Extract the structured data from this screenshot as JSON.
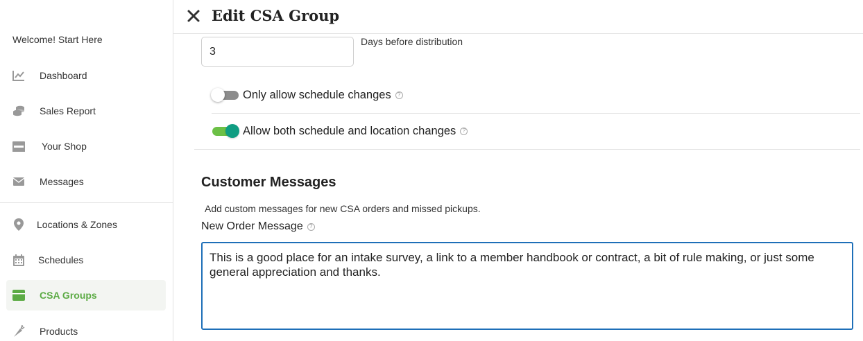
{
  "sidebar": {
    "welcome": "Welcome! Start Here",
    "items": [
      {
        "label": "Dashboard",
        "icon": "chart-line-icon"
      },
      {
        "label": "Sales Report",
        "icon": "coins-icon"
      },
      {
        "label": "Your Shop",
        "icon": "store-icon"
      },
      {
        "label": "Messages",
        "icon": "envelope-icon"
      },
      {
        "label": "Locations & Zones",
        "icon": "map-pin-icon"
      },
      {
        "label": "Schedules",
        "icon": "calendar-icon"
      },
      {
        "label": "CSA Groups",
        "icon": "box-icon",
        "active": true
      },
      {
        "label": "Products",
        "icon": "carrot-icon"
      }
    ]
  },
  "header": {
    "title": "Edit CSA Group"
  },
  "form": {
    "days_value": "3",
    "days_label": "Days before distribution",
    "toggle_schedule_only": {
      "label": "Only allow schedule changes",
      "on": false
    },
    "toggle_schedule_location": {
      "label": "Allow both schedule and location changes",
      "on": true
    },
    "customer_messages": {
      "title": "Customer Messages",
      "description": "Add custom messages for new CSA orders and missed pickups.",
      "new_order_label": "New Order Message",
      "new_order_value": "This is a good place for an intake survey, a link to a member handbook or contract, a bit of rule making, or just some general appreciation and thanks. "
    }
  },
  "colors": {
    "accent_green": "#5cab45",
    "toggle_on_track": "#6cc046",
    "toggle_on_knob": "#0f9d82",
    "focus_blue": "#1e6fb8"
  }
}
